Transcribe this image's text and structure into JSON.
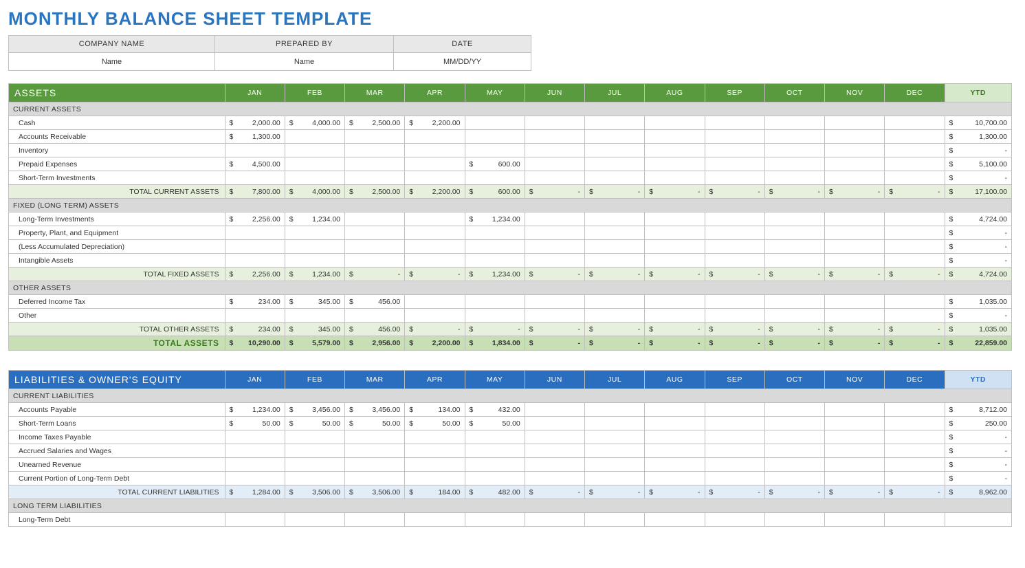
{
  "title": "MONTHLY BALANCE SHEET TEMPLATE",
  "info": {
    "headers": [
      "COMPANY NAME",
      "PREPARED BY",
      "DATE"
    ],
    "values": [
      "Name",
      "Name",
      "MM/DD/YY"
    ]
  },
  "months": [
    "JAN",
    "FEB",
    "MAR",
    "APR",
    "MAY",
    "JUN",
    "JUL",
    "AUG",
    "SEP",
    "OCT",
    "NOV",
    "DEC"
  ],
  "ytd_label": "YTD",
  "assets": {
    "title": "ASSETS",
    "groups": [
      {
        "name": "CURRENT ASSETS",
        "rows": [
          {
            "label": "Cash",
            "vals": [
              "2,000.00",
              "4,000.00",
              "2,500.00",
              "2,200.00",
              "",
              "",
              "",
              "",
              "",
              "",
              "",
              ""
            ],
            "ytd": "10,700.00"
          },
          {
            "label": "Accounts Receivable",
            "vals": [
              "1,300.00",
              "",
              "",
              "",
              "",
              "",
              "",
              "",
              "",
              "",
              "",
              ""
            ],
            "ytd": "1,300.00"
          },
          {
            "label": "Inventory",
            "vals": [
              "",
              "",
              "",
              "",
              "",
              "",
              "",
              "",
              "",
              "",
              "",
              ""
            ],
            "ytd": "-"
          },
          {
            "label": "Prepaid Expenses",
            "vals": [
              "4,500.00",
              "",
              "",
              "",
              "600.00",
              "",
              "",
              "",
              "",
              "",
              "",
              ""
            ],
            "ytd": "5,100.00"
          },
          {
            "label": "Short-Term Investments",
            "vals": [
              "",
              "",
              "",
              "",
              "",
              "",
              "",
              "",
              "",
              "",
              "",
              ""
            ],
            "ytd": "-"
          }
        ],
        "subtotal": {
          "label": "TOTAL CURRENT ASSETS",
          "vals": [
            "7,800.00",
            "4,000.00",
            "2,500.00",
            "2,200.00",
            "600.00",
            "-",
            "-",
            "-",
            "-",
            "-",
            "-",
            "-"
          ],
          "ytd": "17,100.00"
        }
      },
      {
        "name": "FIXED (LONG TERM) ASSETS",
        "rows": [
          {
            "label": "Long-Term Investments",
            "vals": [
              "2,256.00",
              "1,234.00",
              "",
              "",
              "1,234.00",
              "",
              "",
              "",
              "",
              "",
              "",
              ""
            ],
            "ytd": "4,724.00"
          },
          {
            "label": "Property, Plant, and Equipment",
            "vals": [
              "",
              "",
              "",
              "",
              "",
              "",
              "",
              "",
              "",
              "",
              "",
              ""
            ],
            "ytd": "-"
          },
          {
            "label": "(Less Accumulated Depreciation)",
            "vals": [
              "",
              "",
              "",
              "",
              "",
              "",
              "",
              "",
              "",
              "",
              "",
              ""
            ],
            "ytd": "-"
          },
          {
            "label": "Intangible Assets",
            "vals": [
              "",
              "",
              "",
              "",
              "",
              "",
              "",
              "",
              "",
              "",
              "",
              ""
            ],
            "ytd": "-"
          }
        ],
        "subtotal": {
          "label": "TOTAL FIXED ASSETS",
          "vals": [
            "2,256.00",
            "1,234.00",
            "-",
            "-",
            "1,234.00",
            "-",
            "-",
            "-",
            "-",
            "-",
            "-",
            "-"
          ],
          "ytd": "4,724.00"
        }
      },
      {
        "name": "OTHER ASSETS",
        "rows": [
          {
            "label": "Deferred Income Tax",
            "vals": [
              "234.00",
              "345.00",
              "456.00",
              "",
              "",
              "",
              "",
              "",
              "",
              "",
              "",
              ""
            ],
            "ytd": "1,035.00"
          },
          {
            "label": "Other",
            "vals": [
              "",
              "",
              "",
              "",
              "",
              "",
              "",
              "",
              "",
              "",
              "",
              ""
            ],
            "ytd": "-"
          }
        ],
        "subtotal": {
          "label": "TOTAL OTHER ASSETS",
          "vals": [
            "234.00",
            "345.00",
            "456.00",
            "-",
            "-",
            "-",
            "-",
            "-",
            "-",
            "-",
            "-",
            "-"
          ],
          "ytd": "1,035.00"
        }
      }
    ],
    "grand": {
      "label": "TOTAL ASSETS",
      "vals": [
        "10,290.00",
        "5,579.00",
        "2,956.00",
        "2,200.00",
        "1,834.00",
        "-",
        "-",
        "-",
        "-",
        "-",
        "-",
        "-"
      ],
      "ytd": "22,859.00"
    }
  },
  "liab": {
    "title": "LIABILITIES & OWNER'S EQUITY",
    "groups": [
      {
        "name": "CURRENT LIABILITIES",
        "rows": [
          {
            "label": "Accounts Payable",
            "vals": [
              "1,234.00",
              "3,456.00",
              "3,456.00",
              "134.00",
              "432.00",
              "",
              "",
              "",
              "",
              "",
              "",
              ""
            ],
            "ytd": "8,712.00"
          },
          {
            "label": "Short-Term Loans",
            "vals": [
              "50.00",
              "50.00",
              "50.00",
              "50.00",
              "50.00",
              "",
              "",
              "",
              "",
              "",
              "",
              ""
            ],
            "ytd": "250.00"
          },
          {
            "label": "Income Taxes Payable",
            "vals": [
              "",
              "",
              "",
              "",
              "",
              "",
              "",
              "",
              "",
              "",
              "",
              ""
            ],
            "ytd": "-"
          },
          {
            "label": "Accrued Salaries and Wages",
            "vals": [
              "",
              "",
              "",
              "",
              "",
              "",
              "",
              "",
              "",
              "",
              "",
              ""
            ],
            "ytd": "-"
          },
          {
            "label": "Unearned Revenue",
            "vals": [
              "",
              "",
              "",
              "",
              "",
              "",
              "",
              "",
              "",
              "",
              "",
              ""
            ],
            "ytd": "-"
          },
          {
            "label": "Current Portion of Long-Term Debt",
            "vals": [
              "",
              "",
              "",
              "",
              "",
              "",
              "",
              "",
              "",
              "",
              "",
              ""
            ],
            "ytd": "-"
          }
        ],
        "subtotal": {
          "label": "TOTAL CURRENT LIABILITIES",
          "vals": [
            "1,284.00",
            "3,506.00",
            "3,506.00",
            "184.00",
            "482.00",
            "-",
            "-",
            "-",
            "-",
            "-",
            "-",
            "-"
          ],
          "ytd": "8,962.00"
        }
      },
      {
        "name": "LONG TERM LIABILITIES",
        "rows": [
          {
            "label": "Long-Term Debt",
            "vals": [
              "",
              "",
              "",
              "",
              "",
              "",
              "",
              "",
              "",
              "",
              "",
              ""
            ],
            "ytd": ""
          }
        ]
      }
    ]
  }
}
